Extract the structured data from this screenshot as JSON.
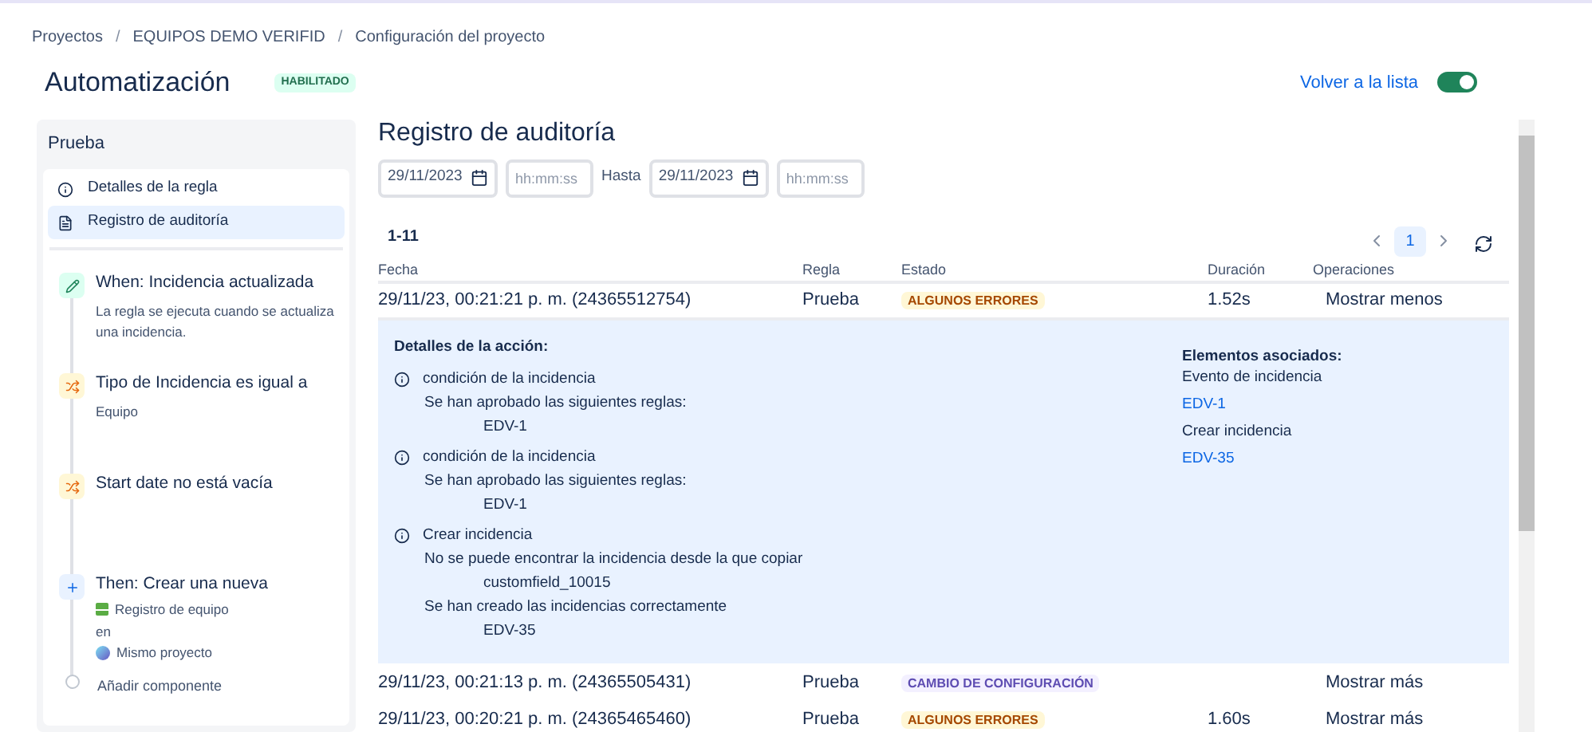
{
  "breadcrumb_separator": "/",
  "breadcrumb": [
    "Proyectos",
    "EQUIPOS DEMO VERIFID",
    "Configuración del proyecto"
  ],
  "header": {
    "title": "Automatización",
    "badge": "HABILITADO",
    "back_link": "Volver a la lista",
    "toggle": {
      "on": true
    }
  },
  "sidebar": {
    "title": "Prueba",
    "nav": [
      {
        "label": "Detalles de la regla",
        "kind": "info",
        "selected": false
      },
      {
        "label": "Registro de auditoría",
        "kind": "log",
        "selected": true
      }
    ],
    "steps": [
      {
        "kind": "trigger",
        "title": "When: Incidencia actualizada",
        "lines": [
          "La regla se ejecuta cuando se actualiza una incidencia."
        ]
      },
      {
        "kind": "condition",
        "title": "Tipo de Incidencia es igual a",
        "lines": [
          "Equipo"
        ]
      },
      {
        "kind": "condition",
        "title": "Start date no está vacía"
      },
      {
        "kind": "action",
        "title": "Then: Crear una nueva",
        "items": [
          {
            "kind": "issue-type",
            "text": "Registro de equipo"
          },
          {
            "kind": "plain",
            "text": "en"
          },
          {
            "kind": "project",
            "text": "Mismo proyecto"
          }
        ]
      },
      {
        "kind": "add",
        "title": "Añadir componente"
      }
    ]
  },
  "main": {
    "title": "Registro de auditoría",
    "filters": {
      "from_date": "29/11/2023",
      "from_time_placeholder": "hh:mm:ss",
      "until_label": "Hasta",
      "to_date": "29/11/2023",
      "to_time_placeholder": "hh:mm:ss"
    },
    "range": "1-11",
    "pagination": [
      {
        "label": "1",
        "selected": true
      }
    ],
    "table": {
      "columns": [
        "Fecha",
        "Regla",
        "Estado",
        "Duración",
        "Operaciones"
      ],
      "rows": [
        {
          "date": "29/11/23, 00:21:21 p. m. (24365512754)",
          "rule": "Prueba",
          "status": {
            "label": "ALGUNOS ERRORES",
            "kind": "warning"
          },
          "duration": "1.52s",
          "operation": "Mostrar menos",
          "expanded": true,
          "details": {
            "title": "Detalles de la acción:",
            "entries": [
              {
                "title": "condición de la incidencia",
                "lines": [
                  {
                    "text": "Se han aprobado las siguientes reglas:",
                    "children": [
                      "EDV-1"
                    ]
                  }
                ]
              },
              {
                "title": "condición de la incidencia",
                "lines": [
                  {
                    "text": "Se han aprobado las siguientes reglas:",
                    "children": [
                      "EDV-1"
                    ]
                  }
                ]
              },
              {
                "title": "Crear incidencia",
                "lines": [
                  {
                    "text": "No se puede encontrar la incidencia desde la que copiar",
                    "children": [
                      "customfield_10015"
                    ]
                  },
                  {
                    "text": "Se han creado las incidencias correctamente",
                    "children": [
                      "EDV-35"
                    ]
                  }
                ]
              }
            ],
            "associated_title": "Elementos asociados:",
            "associated": [
              {
                "kind": "label",
                "text": "Evento de incidencia"
              },
              {
                "kind": "link",
                "text": "EDV-1"
              },
              {
                "kind": "label",
                "text": "Crear incidencia"
              },
              {
                "kind": "link",
                "text": "EDV-35"
              }
            ]
          }
        },
        {
          "date": "29/11/23, 00:21:13 p. m. (24365505431)",
          "rule": "Prueba",
          "status": {
            "label": "CAMBIO DE CONFIGURACIÓN",
            "kind": "config"
          },
          "operation": "Mostrar más",
          "expanded": false
        },
        {
          "date": "29/11/23, 00:20:21 p. m. (24365465460)",
          "rule": "Prueba",
          "status": {
            "label": "ALGUNOS ERRORES",
            "kind": "warning"
          },
          "duration": "1.60s",
          "operation": "Mostrar más",
          "expanded": false
        }
      ]
    }
  }
}
